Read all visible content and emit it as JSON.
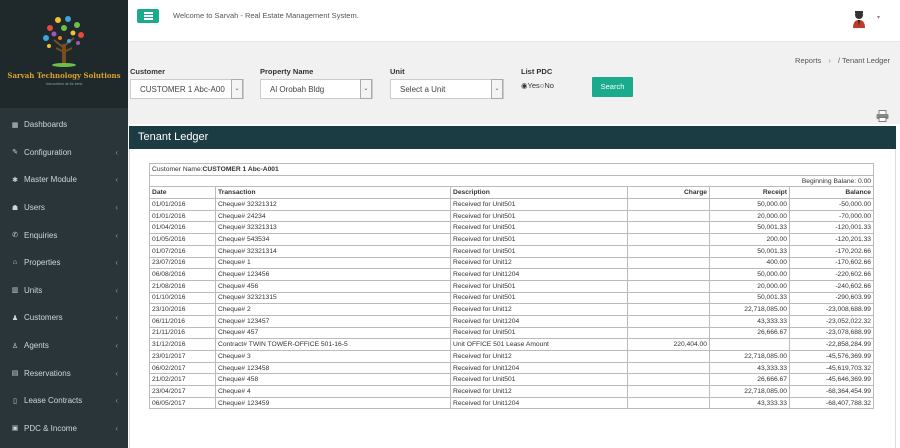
{
  "sidebar": {
    "brand": "Sarvah Technology Solutions",
    "brand_tagline": "Innovation at its best",
    "items": [
      {
        "label": "Dashboards",
        "icon": "dashboard-icon",
        "glyph": "▦",
        "has_children": false
      },
      {
        "label": "Configuration",
        "icon": "wrench-icon",
        "glyph": "✎",
        "has_children": true
      },
      {
        "label": "Master Module",
        "icon": "asterisk-icon",
        "glyph": "✱",
        "has_children": true
      },
      {
        "label": "Users",
        "icon": "users-icon",
        "glyph": "☗",
        "has_children": true
      },
      {
        "label": "Enquiries",
        "icon": "enquiry-icon",
        "glyph": "✆",
        "has_children": true
      },
      {
        "label": "Properties",
        "icon": "bank-icon",
        "glyph": "⌂",
        "has_children": true
      },
      {
        "label": "Units",
        "icon": "units-icon",
        "glyph": "▥",
        "has_children": true
      },
      {
        "label": "Customers",
        "icon": "customer-icon",
        "glyph": "♟",
        "has_children": true
      },
      {
        "label": "Agents",
        "icon": "agent-icon",
        "glyph": "♙",
        "has_children": true
      },
      {
        "label": "Reservations",
        "icon": "reservation-icon",
        "glyph": "▤",
        "has_children": true
      },
      {
        "label": "Lease Contracts",
        "icon": "file-icon",
        "glyph": "▯",
        "has_children": true
      },
      {
        "label": "PDC & Income",
        "icon": "money-icon",
        "glyph": "▣",
        "has_children": true
      }
    ]
  },
  "header": {
    "welcome": "Welcome to Sarvah - Real Estate Management System."
  },
  "breadcrumb": {
    "parent": "Reports",
    "separator": "›",
    "slash": "/",
    "current": "Tenant Ledger"
  },
  "filters": {
    "customer_label": "Customer",
    "customer_value": "CUSTOMER 1 Abc-A00",
    "property_label": "Property Name",
    "property_value": "Al Orobah Bldg",
    "unit_label": "Unit",
    "unit_value": "Select a Unit",
    "pdc_label": "List PDC",
    "pdc_yes": "Yes",
    "pdc_no": "No",
    "pdc_selected": "Yes",
    "search_label": "Search"
  },
  "panel": {
    "title": "Tenant Ledger"
  },
  "ledger": {
    "customer_prefix": "Customer Name:",
    "customer_name": "CUSTOMER 1 Abc-A001",
    "beginning_balance": "Beginning Balane: 0.00",
    "columns": [
      "Date",
      "Transaction",
      "Description",
      "Charge",
      "Receipt",
      "Balance"
    ],
    "rows": [
      [
        "01/01/2016",
        "Cheque# 32321312",
        "Received for Unit501",
        "",
        "50,000.00",
        "-50,000.00"
      ],
      [
        "01/01/2016",
        "Cheque# 24234",
        "Received for Unit501",
        "",
        "20,000.00",
        "-70,000.00"
      ],
      [
        "01/04/2016",
        "Cheque# 32321313",
        "Received for Unit501",
        "",
        "50,001.33",
        "-120,001.33"
      ],
      [
        "01/05/2016",
        "Cheque# 543534",
        "Received for Unit501",
        "",
        "200.00",
        "-120,201.33"
      ],
      [
        "01/07/2016",
        "Cheque# 32321314",
        "Received for Unit501",
        "",
        "50,001.33",
        "-170,202.66"
      ],
      [
        "23/07/2016",
        "Cheque# 1",
        "Received for Unit12",
        "",
        "400.00",
        "-170,602.66"
      ],
      [
        "06/08/2016",
        "Cheque# 123456",
        "Received for Unit1204",
        "",
        "50,000.00",
        "-220,602.66"
      ],
      [
        "21/08/2016",
        "Cheque# 456",
        "Received for Unit501",
        "",
        "20,000.00",
        "-240,602.66"
      ],
      [
        "01/10/2016",
        "Cheque# 32321315",
        "Received for Unit501",
        "",
        "50,001.33",
        "-290,603.99"
      ],
      [
        "23/10/2016",
        "Cheque# 2",
        "Received for Unit12",
        "",
        "22,718,085.00",
        "-23,008,688.99"
      ],
      [
        "06/11/2016",
        "Cheque# 123457",
        "Received for Unit1204",
        "",
        "43,333.33",
        "-23,052,022.32"
      ],
      [
        "21/11/2016",
        "Cheque# 457",
        "Received for Unit501",
        "",
        "26,666.67",
        "-23,078,688.99"
      ],
      [
        "31/12/2016",
        "Contract# TWIN TOWER-OFFICE 501-16-5",
        "Unit OFFICE 501 Lease Amount",
        "220,404.00",
        "",
        "-22,858,284.99"
      ],
      [
        "23/01/2017",
        "Cheque# 3",
        "Received for Unit12",
        "",
        "22,718,085.00",
        "-45,576,369.99"
      ],
      [
        "06/02/2017",
        "Cheque# 123458",
        "Received for Unit1204",
        "",
        "43,333.33",
        "-45,619,703.32"
      ],
      [
        "21/02/2017",
        "Cheque# 458",
        "Received for Unit501",
        "",
        "26,666.67",
        "-45,646,369.99"
      ],
      [
        "23/04/2017",
        "Cheque# 4",
        "Received for Unit12",
        "",
        "22,718,085.00",
        "-68,364,454.99"
      ],
      [
        "06/05/2017",
        "Cheque# 123459",
        "Received for Unit1204",
        "",
        "43,333.33",
        "-68,407,788.32"
      ]
    ]
  },
  "colors": {
    "sidebar_bg": "#2a3539",
    "accent": "#1aaa8c",
    "panel_header": "#1c3c44"
  }
}
